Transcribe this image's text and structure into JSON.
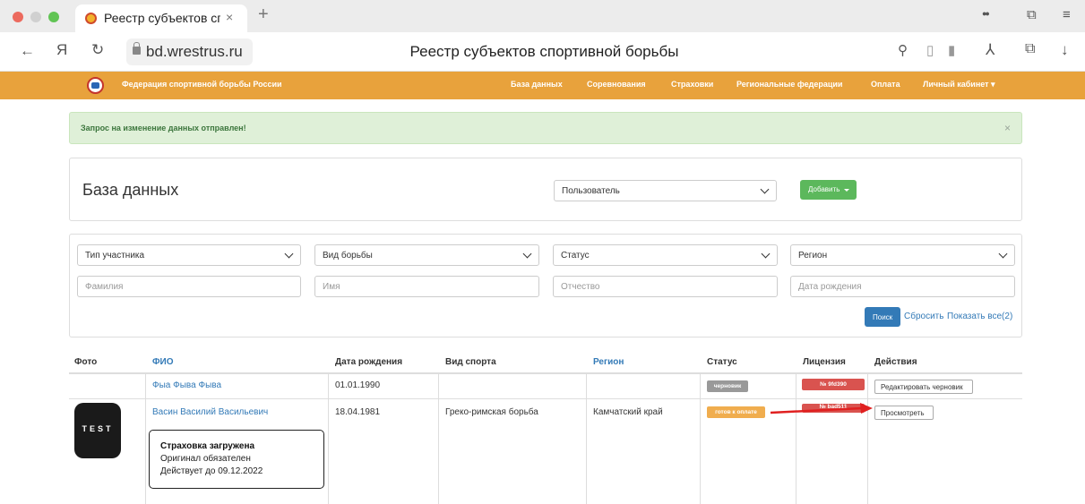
{
  "browser": {
    "tab_title": "Реестр субъектов спо",
    "tab_close": "×",
    "new_tab": "+",
    "url": "bd.wrestrus.ru",
    "page_title": "Реестр субъектов спортивной борьбы",
    "colors": {
      "close": "#ec6a5e",
      "minimize": "#d0d0d0",
      "zoom": "#61c454"
    },
    "icons": {
      "back": "←",
      "yandex": "Я",
      "reload": "↻",
      "search": "⚲",
      "reader": "▯",
      "bookmark": "▮",
      "protect": "⅄",
      "downloads": "↓",
      "tab_list": "⧉",
      "menu": "≡",
      "glasses": "●●"
    }
  },
  "site": {
    "brand": "Федерация спортивной борьбы России",
    "accent": "#e8a23c",
    "nav": [
      "База данных",
      "Соревнования",
      "Страховки",
      "Региональные федерации",
      "Оплата",
      "Личный кабинет ▾"
    ]
  },
  "alert": {
    "text": "Запрос на изменение данных отправлен!",
    "close": "×"
  },
  "db_panel": {
    "title": "База данных",
    "entity_select": "Пользователь",
    "add_button": "Добавить"
  },
  "filters": {
    "participant_type": "Тип участника",
    "wrestling_type": "Вид борьбы",
    "status": "Статус",
    "region": "Регион",
    "surname_placeholder": "Фамилия",
    "name_placeholder": "Имя",
    "patronymic_placeholder": "Отчество",
    "birthdate_placeholder": "Дата рождения",
    "search_button": "Поиск",
    "reset_link": "Сбросить",
    "show_all_link": "Показать все(2)"
  },
  "table": {
    "headers": [
      "Фото",
      "ФИО",
      "Дата рождения",
      "Вид спорта",
      "Регион",
      "Статус",
      "Лицензия",
      "Действия"
    ],
    "rows": [
      {
        "fio": "Фыа Фыва Фыва",
        "birthdate": "01.01.1990",
        "sport": "",
        "region": "",
        "status": "черновик",
        "status_color": "#999999",
        "license": "№ 9fd390",
        "license_color": "#d9534f",
        "action": "Редактировать черновик"
      },
      {
        "photo_text": "TEST",
        "fio": "Васин Василий Васильевич",
        "birthdate": "18.04.1981",
        "sport": "Греко-римская борьба",
        "region": "Камчатский край",
        "status": "готов к оплате",
        "status_color": "#f0ad4e",
        "license": "№ bad511",
        "license_color": "#d9534f",
        "action": "Просмотреть",
        "insurance": {
          "title": "Страховка загружена",
          "line1": "Оригинал обязателен",
          "line2": "Действует до 09.12.2022"
        }
      }
    ]
  },
  "annotation": {
    "arrow_color": "#e02020"
  }
}
